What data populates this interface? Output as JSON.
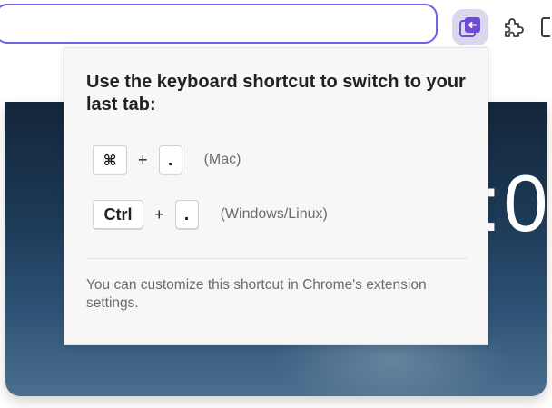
{
  "toolbar": {
    "omnibox_value": "",
    "extension_icon": "switch-to-last-tab-icon",
    "extensions_icon": "puzzle-icon",
    "side_panel_icon": "side-panel-icon"
  },
  "background": {
    "clock_fragment": ":0"
  },
  "popup": {
    "title": "Use the keyboard shortcut to switch to your last tab:",
    "shortcuts": [
      {
        "keys": [
          "⌘",
          "."
        ],
        "plus": "+",
        "platform": "(Mac)"
      },
      {
        "keys": [
          "Ctrl",
          "."
        ],
        "plus": "+",
        "platform": "(Windows/Linux)"
      }
    ],
    "footnote": "You can customize this shortcut in Chrome's extension settings."
  },
  "colors": {
    "accent": "#6b63e8",
    "extension_active_bg": "#d9d9eb",
    "extension_icon_color": "#6d4bd6"
  }
}
